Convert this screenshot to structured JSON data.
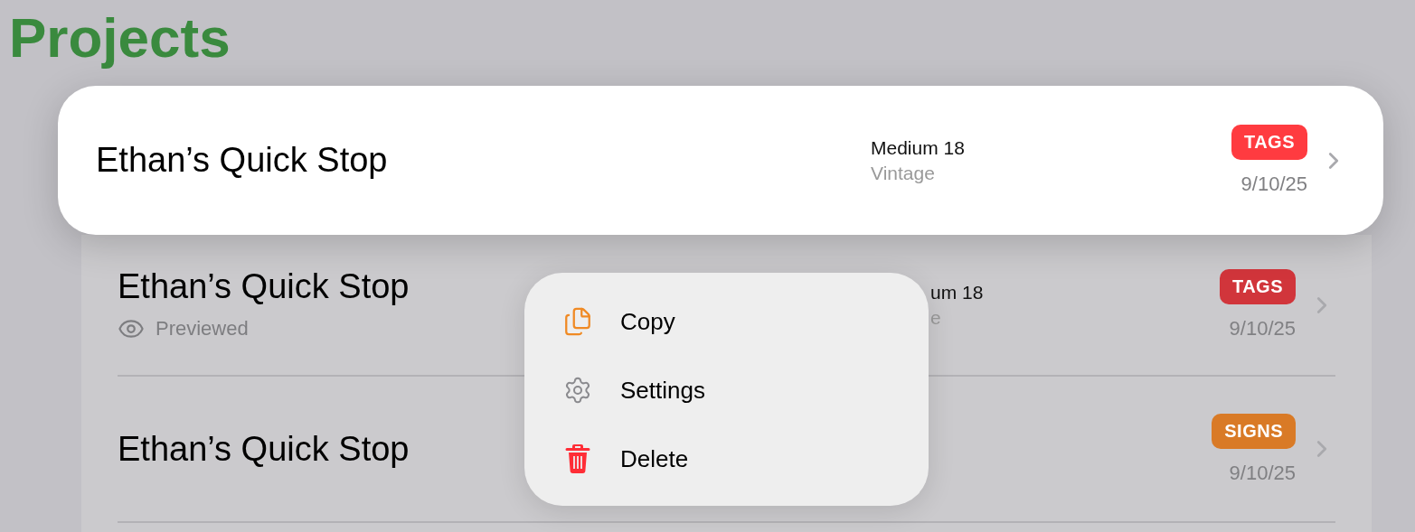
{
  "title": "Projects",
  "focused": {
    "name": "Ethan’s Quick Stop",
    "meta": [
      "Medium 18",
      "Vintage"
    ],
    "tag": {
      "label": "TAGS",
      "color": "#ff3b40"
    },
    "date": "9/10/25"
  },
  "rows": [
    {
      "name": "Ethan’s Quick Stop",
      "status": "Previewed",
      "meta": [
        "um 18",
        "e"
      ],
      "covered": true,
      "tag": {
        "label": "TAGS",
        "color": "#d1353b"
      },
      "date": "9/10/25"
    },
    {
      "name": "Ethan’s Quick Stop",
      "tag": {
        "label": "SIGNS",
        "color": "#d97a26"
      },
      "date": "9/10/25"
    }
  ],
  "menu": [
    {
      "label": "Copy",
      "kind": "copy"
    },
    {
      "label": "Settings",
      "kind": "settings"
    },
    {
      "label": "Delete",
      "kind": "delete"
    }
  ]
}
